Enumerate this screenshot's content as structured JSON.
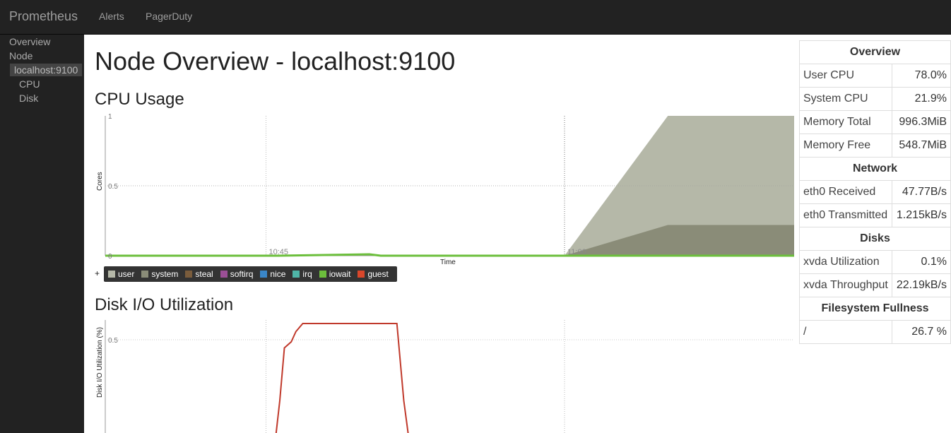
{
  "navbar": {
    "brand": "Prometheus",
    "links": [
      "Alerts",
      "PagerDuty"
    ]
  },
  "sidebar": {
    "items": [
      {
        "label": "Overview"
      },
      {
        "label": "Node"
      },
      {
        "label": "localhost:9100",
        "active": true
      },
      {
        "label": "CPU"
      },
      {
        "label": "Disk"
      }
    ]
  },
  "main": {
    "title": "Node Overview - localhost:9100",
    "cpu_section": "CPU Usage",
    "disk_section": "Disk I/O Utilization"
  },
  "legend": {
    "plus": "+",
    "items": [
      {
        "label": "user",
        "color": "#b5b8a8"
      },
      {
        "label": "system",
        "color": "#8a8c78"
      },
      {
        "label": "steal",
        "color": "#7a5c3c"
      },
      {
        "label": "softirq",
        "color": "#9b4f96"
      },
      {
        "label": "nice",
        "color": "#3a86c8"
      },
      {
        "label": "irq",
        "color": "#4fb6a8"
      },
      {
        "label": "iowait",
        "color": "#6cbf3c"
      },
      {
        "label": "guest",
        "color": "#d9472b"
      }
    ]
  },
  "chart_data": [
    {
      "type": "area",
      "ylabel": "Cores",
      "xlabel": "Time",
      "ylim": [
        0,
        1
      ],
      "y_ticks": [
        "0",
        "0.5",
        "1"
      ],
      "x_ticks": [
        "10:45",
        "11:00"
      ],
      "series": [
        {
          "name": "user",
          "color": "#b5b8a8",
          "x_minutes": [
            0,
            10.5,
            20,
            24.5,
            30
          ],
          "values": [
            0,
            0,
            0,
            1.0,
            1.0
          ]
        },
        {
          "name": "system",
          "color": "#8a8c78",
          "x_minutes": [
            0,
            10.5,
            20,
            24.5,
            30
          ],
          "values": [
            0,
            0,
            0,
            0.22,
            0.22
          ]
        },
        {
          "name": "iowait",
          "color": "#6cbf3c",
          "x_minutes": [
            0,
            7.5,
            11.5,
            12,
            30
          ],
          "values": [
            0,
            0,
            0.01,
            0,
            0
          ]
        }
      ]
    },
    {
      "type": "line",
      "ylabel": "Disk I/O Utilization (%)",
      "y_ticks": [
        "0.5"
      ],
      "series": [
        {
          "name": "xvda",
          "color": "#c0392b",
          "x_minutes": [
            7.4,
            7.6,
            7.8,
            8.1,
            8.3,
            8.6,
            9.0,
            12.5,
            12.7,
            13.0,
            13.2,
            13.3
          ],
          "values": [
            0.0,
            0.2,
            0.46,
            0.49,
            0.54,
            0.58,
            0.58,
            0.58,
            0.58,
            0.2,
            0.03,
            0.02
          ]
        }
      ]
    }
  ],
  "stats": {
    "sections": [
      {
        "title": "Overview",
        "rows": [
          {
            "label": "User CPU",
            "value": "78.0%"
          },
          {
            "label": "System CPU",
            "value": "21.9%"
          },
          {
            "label": "Memory Total",
            "value": "996.3MiB"
          },
          {
            "label": "Memory Free",
            "value": "548.7MiB"
          }
        ]
      },
      {
        "title": "Network",
        "rows": [
          {
            "label": "eth0 Received",
            "value": "47.77B/s"
          },
          {
            "label": "eth0 Transmitted",
            "value": "1.215kB/s"
          }
        ]
      },
      {
        "title": "Disks",
        "rows": [
          {
            "label": "xvda Utilization",
            "value": "0.1%"
          },
          {
            "label": "xvda Throughput",
            "value": "22.19kB/s"
          }
        ]
      },
      {
        "title": "Filesystem Fullness",
        "rows": [
          {
            "label": "/",
            "value": "26.7 %"
          }
        ]
      }
    ]
  }
}
